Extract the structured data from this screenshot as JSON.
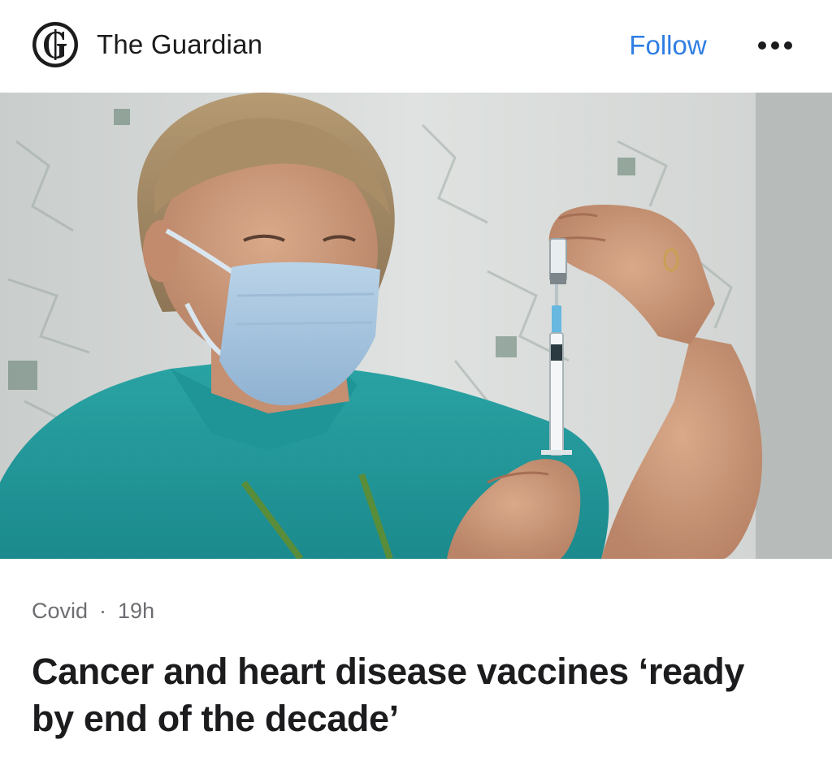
{
  "publisher": {
    "name": "The Guardian",
    "logo_icon": "guardian-g-logo"
  },
  "header": {
    "follow_label": "Follow",
    "more_icon": "ellipsis-icon"
  },
  "hero_image": {
    "description_icon": "photo-vaccine-syringe"
  },
  "article": {
    "category": "Covid",
    "separator": "·",
    "age": "19h",
    "headline": "Cancer and heart disease vaccines ‘ready by end of the decade’"
  },
  "colors": {
    "accent": "#2f7ee3",
    "text": "#1c1c1e",
    "meta": "#6d6d72"
  }
}
